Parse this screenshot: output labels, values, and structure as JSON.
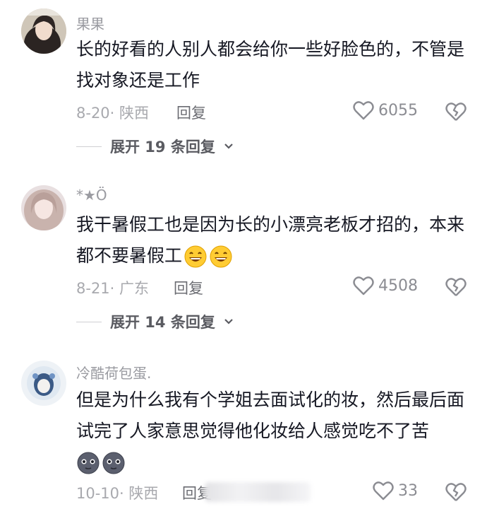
{
  "comments": [
    {
      "username": "果果",
      "text": "长的好看的人别人都会给你一些好脸色的，不管是找对象还是工作",
      "date": "8-20",
      "location": "陕西",
      "reply_label": "回复",
      "likes": "6055",
      "expand_label": "展开 19 条回复"
    },
    {
      "username": "*★Ö",
      "text": "我干暑假工也是因为长的小漂亮老板才招的，本来都不要暑假工",
      "emoji": [
        "grin-emoji",
        "grin-emoji"
      ],
      "date": "8-21",
      "location": "广东",
      "reply_label": "回复",
      "likes": "4508",
      "expand_label": "展开 14 条回复"
    },
    {
      "username": "冷酷荷包蛋.",
      "text": "但是为什么我有个学姐去面试化的妆，然后最后面试完了人家意思觉得他化妆给人感觉吃不了苦",
      "emoji": [
        "moon-face-emoji",
        "moon-face-emoji"
      ],
      "date": "10-10",
      "location": "陕西",
      "reply_label": "回复",
      "likes": "33"
    }
  ],
  "separator": "·",
  "colors": {
    "text": "#161823",
    "meta": "#a8a9ae",
    "username": "#9a9ba1"
  }
}
